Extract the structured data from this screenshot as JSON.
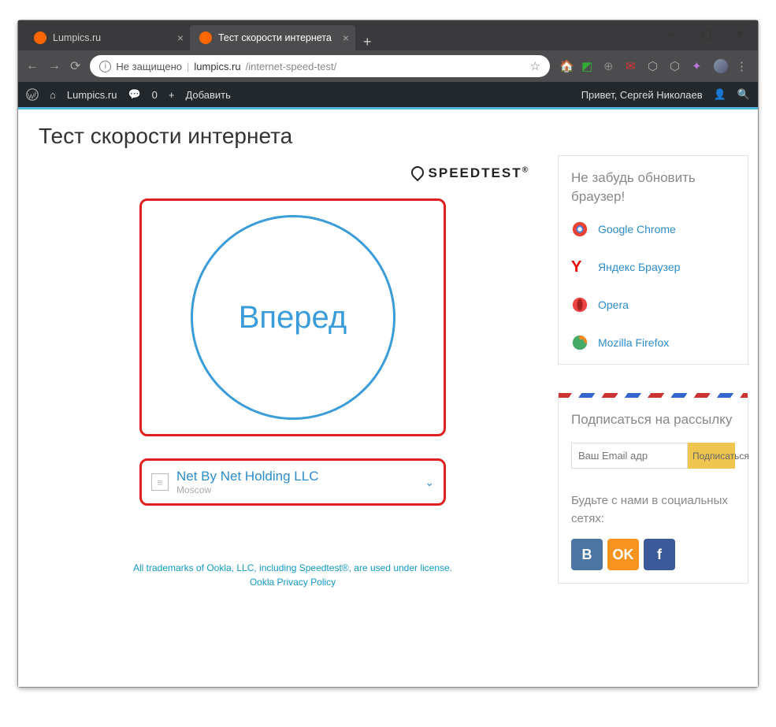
{
  "window": {
    "tabs": [
      {
        "title": "Lumpics.ru"
      },
      {
        "title": "Тест скорости интернета"
      }
    ]
  },
  "address": {
    "insecure": "Не защищено",
    "domain": "lumpics.ru",
    "path": "/internet-speed-test/"
  },
  "wp": {
    "site": "Lumpics.ru",
    "comments": "0",
    "add": "Добавить",
    "greeting": "Привет, Сергей Николаев"
  },
  "page": {
    "title": "Тест скорости интернета",
    "brand": "SPEEDTEST",
    "go": "Вперед"
  },
  "server": {
    "name": "Net By Net Holding LLC",
    "location": "Moscow"
  },
  "legal": {
    "l1": "All trademarks of Ookla, LLC, including Speedtest®, are used under license.",
    "l2": "Ookla Privacy Policy"
  },
  "update": {
    "title": "Не забудь обновить браузер!",
    "items": [
      "Google Chrome",
      "Яндекс Браузер",
      "Opera",
      "Mozilla Firefox"
    ]
  },
  "subscribe": {
    "title": "Подписаться на рассылку",
    "placeholder": "Ваш Email адр",
    "button": "Подписаться"
  },
  "social": {
    "title": "Будьте с нами в социальных сетях:"
  }
}
